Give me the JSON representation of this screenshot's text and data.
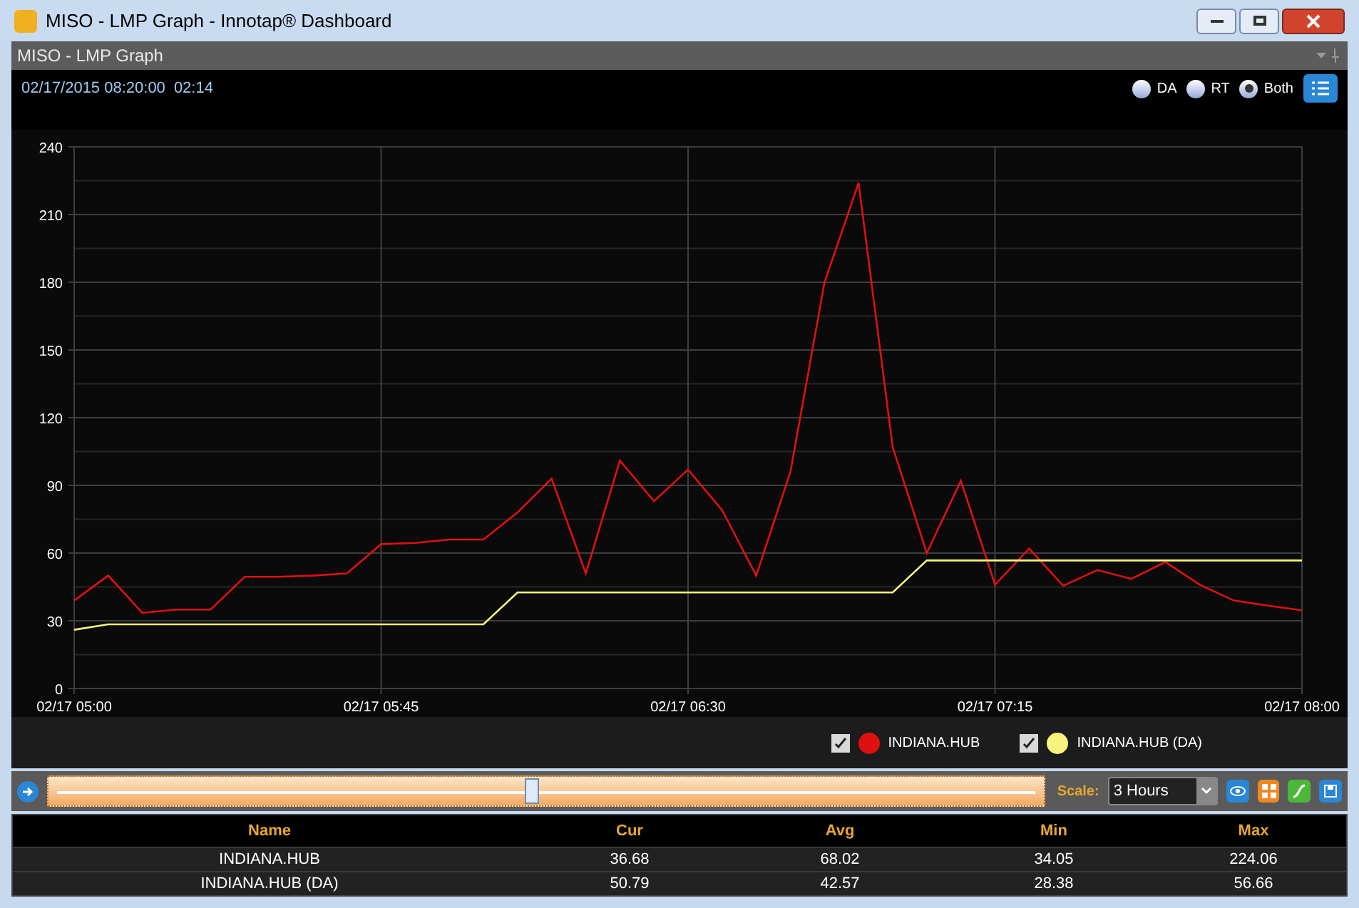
{
  "window": {
    "title": "MISO - LMP Graph - Innotap® Dashboard"
  },
  "panel": {
    "title": "MISO - LMP Graph"
  },
  "header": {
    "timestamp": "02/17/2015 08:20:00",
    "elapsed": "02:14"
  },
  "modes": [
    {
      "label": "DA",
      "selected": false
    },
    {
      "label": "RT",
      "selected": false
    },
    {
      "label": "Both",
      "selected": true
    }
  ],
  "chart_data": {
    "type": "line",
    "categories": [
      "02/17 05:00",
      null,
      null,
      null,
      null,
      null,
      null,
      null,
      null,
      "02/17 05:45",
      null,
      null,
      null,
      null,
      null,
      null,
      null,
      null,
      "02/17 06:30",
      null,
      null,
      null,
      null,
      null,
      null,
      null,
      null,
      "02/17 07:15",
      null,
      null,
      null,
      null,
      null,
      null,
      null,
      null,
      "02/17 08:00"
    ],
    "series": [
      {
        "name": "INDIANA.HUB",
        "color": "#e01010",
        "values": [
          39,
          50,
          33.5,
          35,
          35,
          49.5,
          49.5,
          50,
          51,
          64,
          64.5,
          66,
          66,
          78,
          93,
          51,
          101,
          83,
          97,
          79,
          50,
          96,
          180,
          224,
          107,
          60,
          92,
          46,
          62,
          45.5,
          52.5,
          48.6,
          56,
          46,
          39,
          36.7,
          34.7
        ]
      },
      {
        "name": "INDIANA.HUB (DA)",
        "color": "#f6f47e",
        "values": [
          26,
          28.4,
          28.4,
          28.4,
          28.4,
          28.4,
          28.4,
          28.4,
          28.4,
          28.4,
          28.4,
          28.4,
          28.4,
          42.6,
          42.6,
          42.6,
          42.6,
          42.6,
          42.6,
          42.6,
          42.6,
          42.6,
          42.6,
          42.6,
          42.6,
          56.7,
          56.7,
          56.7,
          56.7,
          56.7,
          56.7,
          56.7,
          56.7,
          56.7,
          56.7,
          56.7,
          56.7
        ]
      }
    ],
    "grid": true,
    "ylim": [
      0,
      240
    ],
    "yticks": [
      0,
      30,
      60,
      90,
      120,
      150,
      180,
      210,
      240
    ]
  },
  "legend": [
    {
      "checked": true
    },
    {
      "checked": true
    }
  ],
  "timeline": {
    "level": 0.485,
    "scale_label": "Scale:",
    "scale_value": "3 Hours"
  },
  "table": {
    "columns": [
      "Name",
      "Cur",
      "Avg",
      "Min",
      "Max"
    ],
    "rows": [
      [
        "INDIANA.HUB",
        "36.68",
        "68.02",
        "34.05",
        "224.06"
      ],
      [
        "INDIANA.HUB (DA)",
        "50.79",
        "42.57",
        "28.38",
        "56.66"
      ]
    ]
  }
}
